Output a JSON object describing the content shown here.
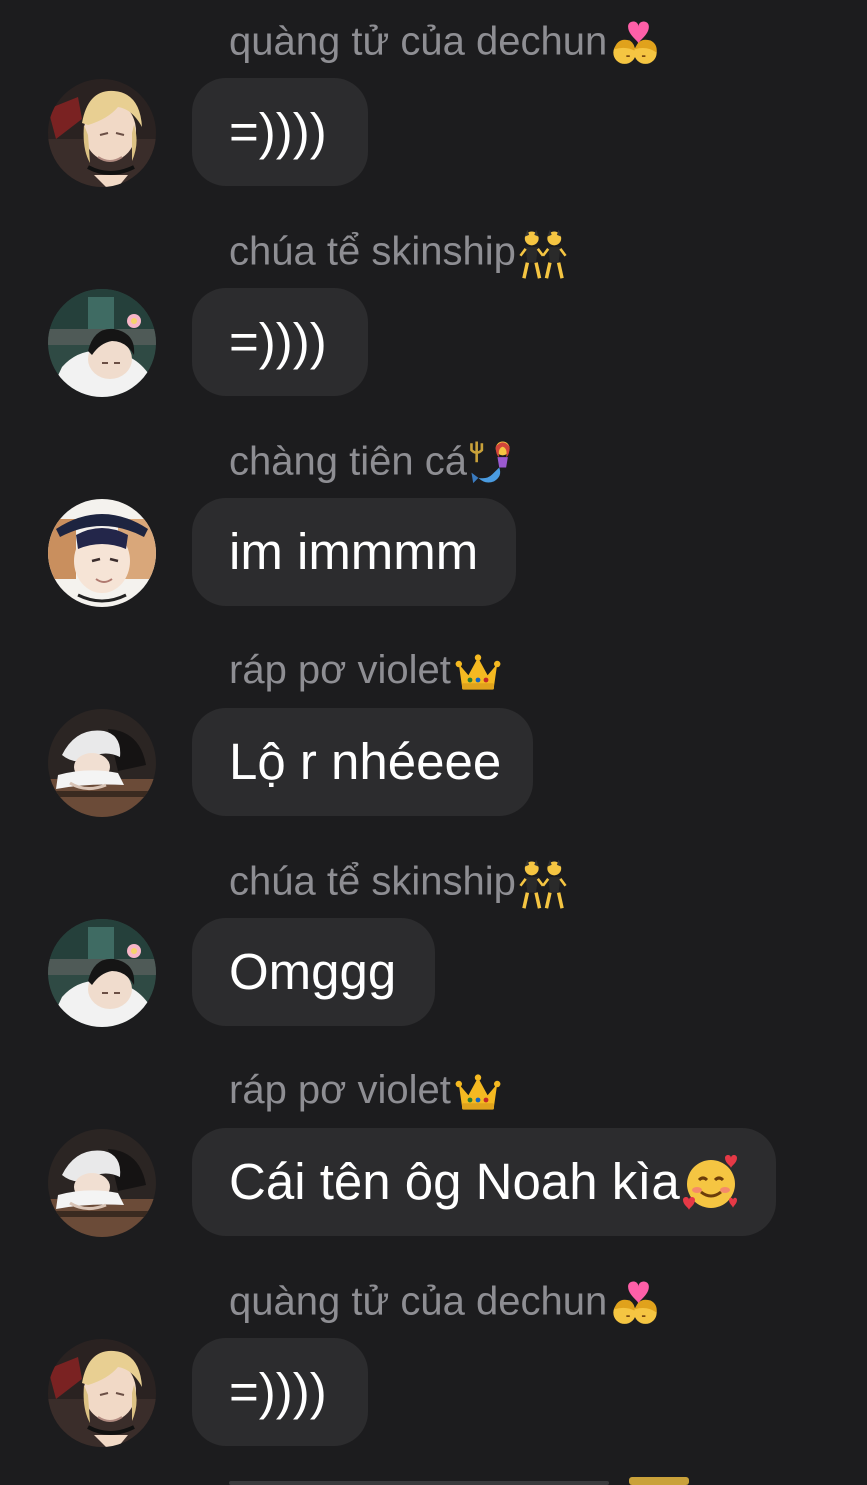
{
  "messages": [
    {
      "sender_name": "quàng tử của dechun",
      "sender_emoji": "kiss-couple-emoji",
      "text": "=))))",
      "text_emoji": "",
      "avatar": "avatar-blond-boy",
      "bubble_width": 0
    },
    {
      "sender_name": "chúa tể skinship",
      "sender_emoji": "dancing-twins-emoji",
      "text": "=))))",
      "text_emoji": "",
      "avatar": "avatar-dark-hair-flower"
    },
    {
      "sender_name": "chàng tiên cá",
      "sender_emoji": "mermaid-emoji",
      "text": "im immmm",
      "text_emoji": "",
      "avatar": "avatar-hat-boy"
    },
    {
      "sender_name": "ráp pơ violet",
      "sender_emoji": "crown-emoji",
      "text": "Lộ r nhéeee",
      "text_emoji": "",
      "avatar": "avatar-white-hair"
    },
    {
      "sender_name": "chúa tể skinship",
      "sender_emoji": "dancing-twins-emoji",
      "text": "Omggg",
      "text_emoji": "",
      "avatar": "avatar-dark-hair-flower"
    },
    {
      "sender_name": "ráp pơ violet",
      "sender_emoji": "crown-emoji",
      "text": "Cái tên ôg Noah kìa",
      "text_emoji": "smiling-face-with-hearts-emoji",
      "avatar": "avatar-white-hair"
    },
    {
      "sender_name": "quàng tử của dechun",
      "sender_emoji": "kiss-couple-emoji",
      "text": "=))))",
      "text_emoji": "",
      "avatar": "avatar-blond-boy"
    }
  ],
  "colors": {
    "background": "#1c1c1e",
    "bubble": "#2c2c2e",
    "sender_text": "#8e8e93",
    "message_text": "#ffffff"
  }
}
